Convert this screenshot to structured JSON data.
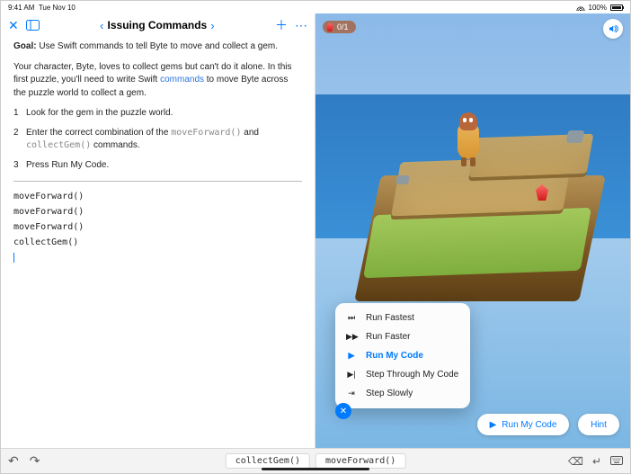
{
  "status": {
    "time": "9:41 AM",
    "date": "Tue Nov 10",
    "battery_pct": "100%"
  },
  "toolbar": {
    "title": "Issuing Commands"
  },
  "doc": {
    "goal_label": "Goal:",
    "goal_text": "Use Swift commands to tell Byte to move and collect a gem.",
    "intro_a": "Your character, Byte, loves to collect gems but can't do it alone. In this first puzzle, you'll need to write Swift ",
    "intro_link": "commands",
    "intro_b": " to move Byte across the puzzle world to collect a gem.",
    "steps": [
      "Look for the gem in the puzzle world.",
      "Enter the correct combination of the ",
      "Press Run My Code."
    ],
    "step2_code_a": "moveForward()",
    "step2_mid": " and ",
    "step2_code_b": "collectGem()",
    "step2_tail": " commands."
  },
  "code_lines": [
    "moveForward()",
    "moveForward()",
    "moveForward()",
    "collectGem()"
  ],
  "scene": {
    "score": "0/1"
  },
  "speed_menu": {
    "items": [
      {
        "icon": "⏭",
        "label": "Run Fastest"
      },
      {
        "icon": "▶▶",
        "label": "Run Faster"
      },
      {
        "icon": "▶",
        "label": "Run My Code",
        "selected": true
      },
      {
        "icon": "▶|",
        "label": "Step Through My Code"
      },
      {
        "icon": "⇥",
        "label": "Step Slowly"
      }
    ]
  },
  "buttons": {
    "run": "Run My Code",
    "hint": "Hint"
  },
  "suggestions": [
    "collectGem()",
    "moveForward()"
  ]
}
